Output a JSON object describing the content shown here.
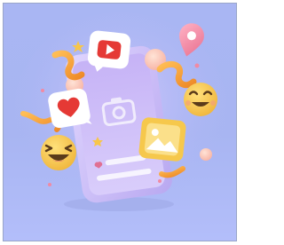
{
  "scene": {
    "subject": "social-media-phone-illustration",
    "colors": {
      "background": "#a8b5f2",
      "phone": "#cdbcf6",
      "youtube_red": "#e53935",
      "heart_red": "#e53935",
      "emoji_yellow": "#f7c64a",
      "location_pink": "#f08aa4",
      "ribbon_orange": "#f4a23a",
      "gallery_yellow": "#f6c84c"
    },
    "icons": [
      "phone-icon",
      "play-button-icon",
      "heart-icon",
      "camera-icon",
      "gallery-image-icon",
      "location-pin-icon",
      "laughing-emoji-icon",
      "smiling-emoji-icon",
      "star-icon",
      "ribbon-icon",
      "bubble-icon"
    ]
  }
}
